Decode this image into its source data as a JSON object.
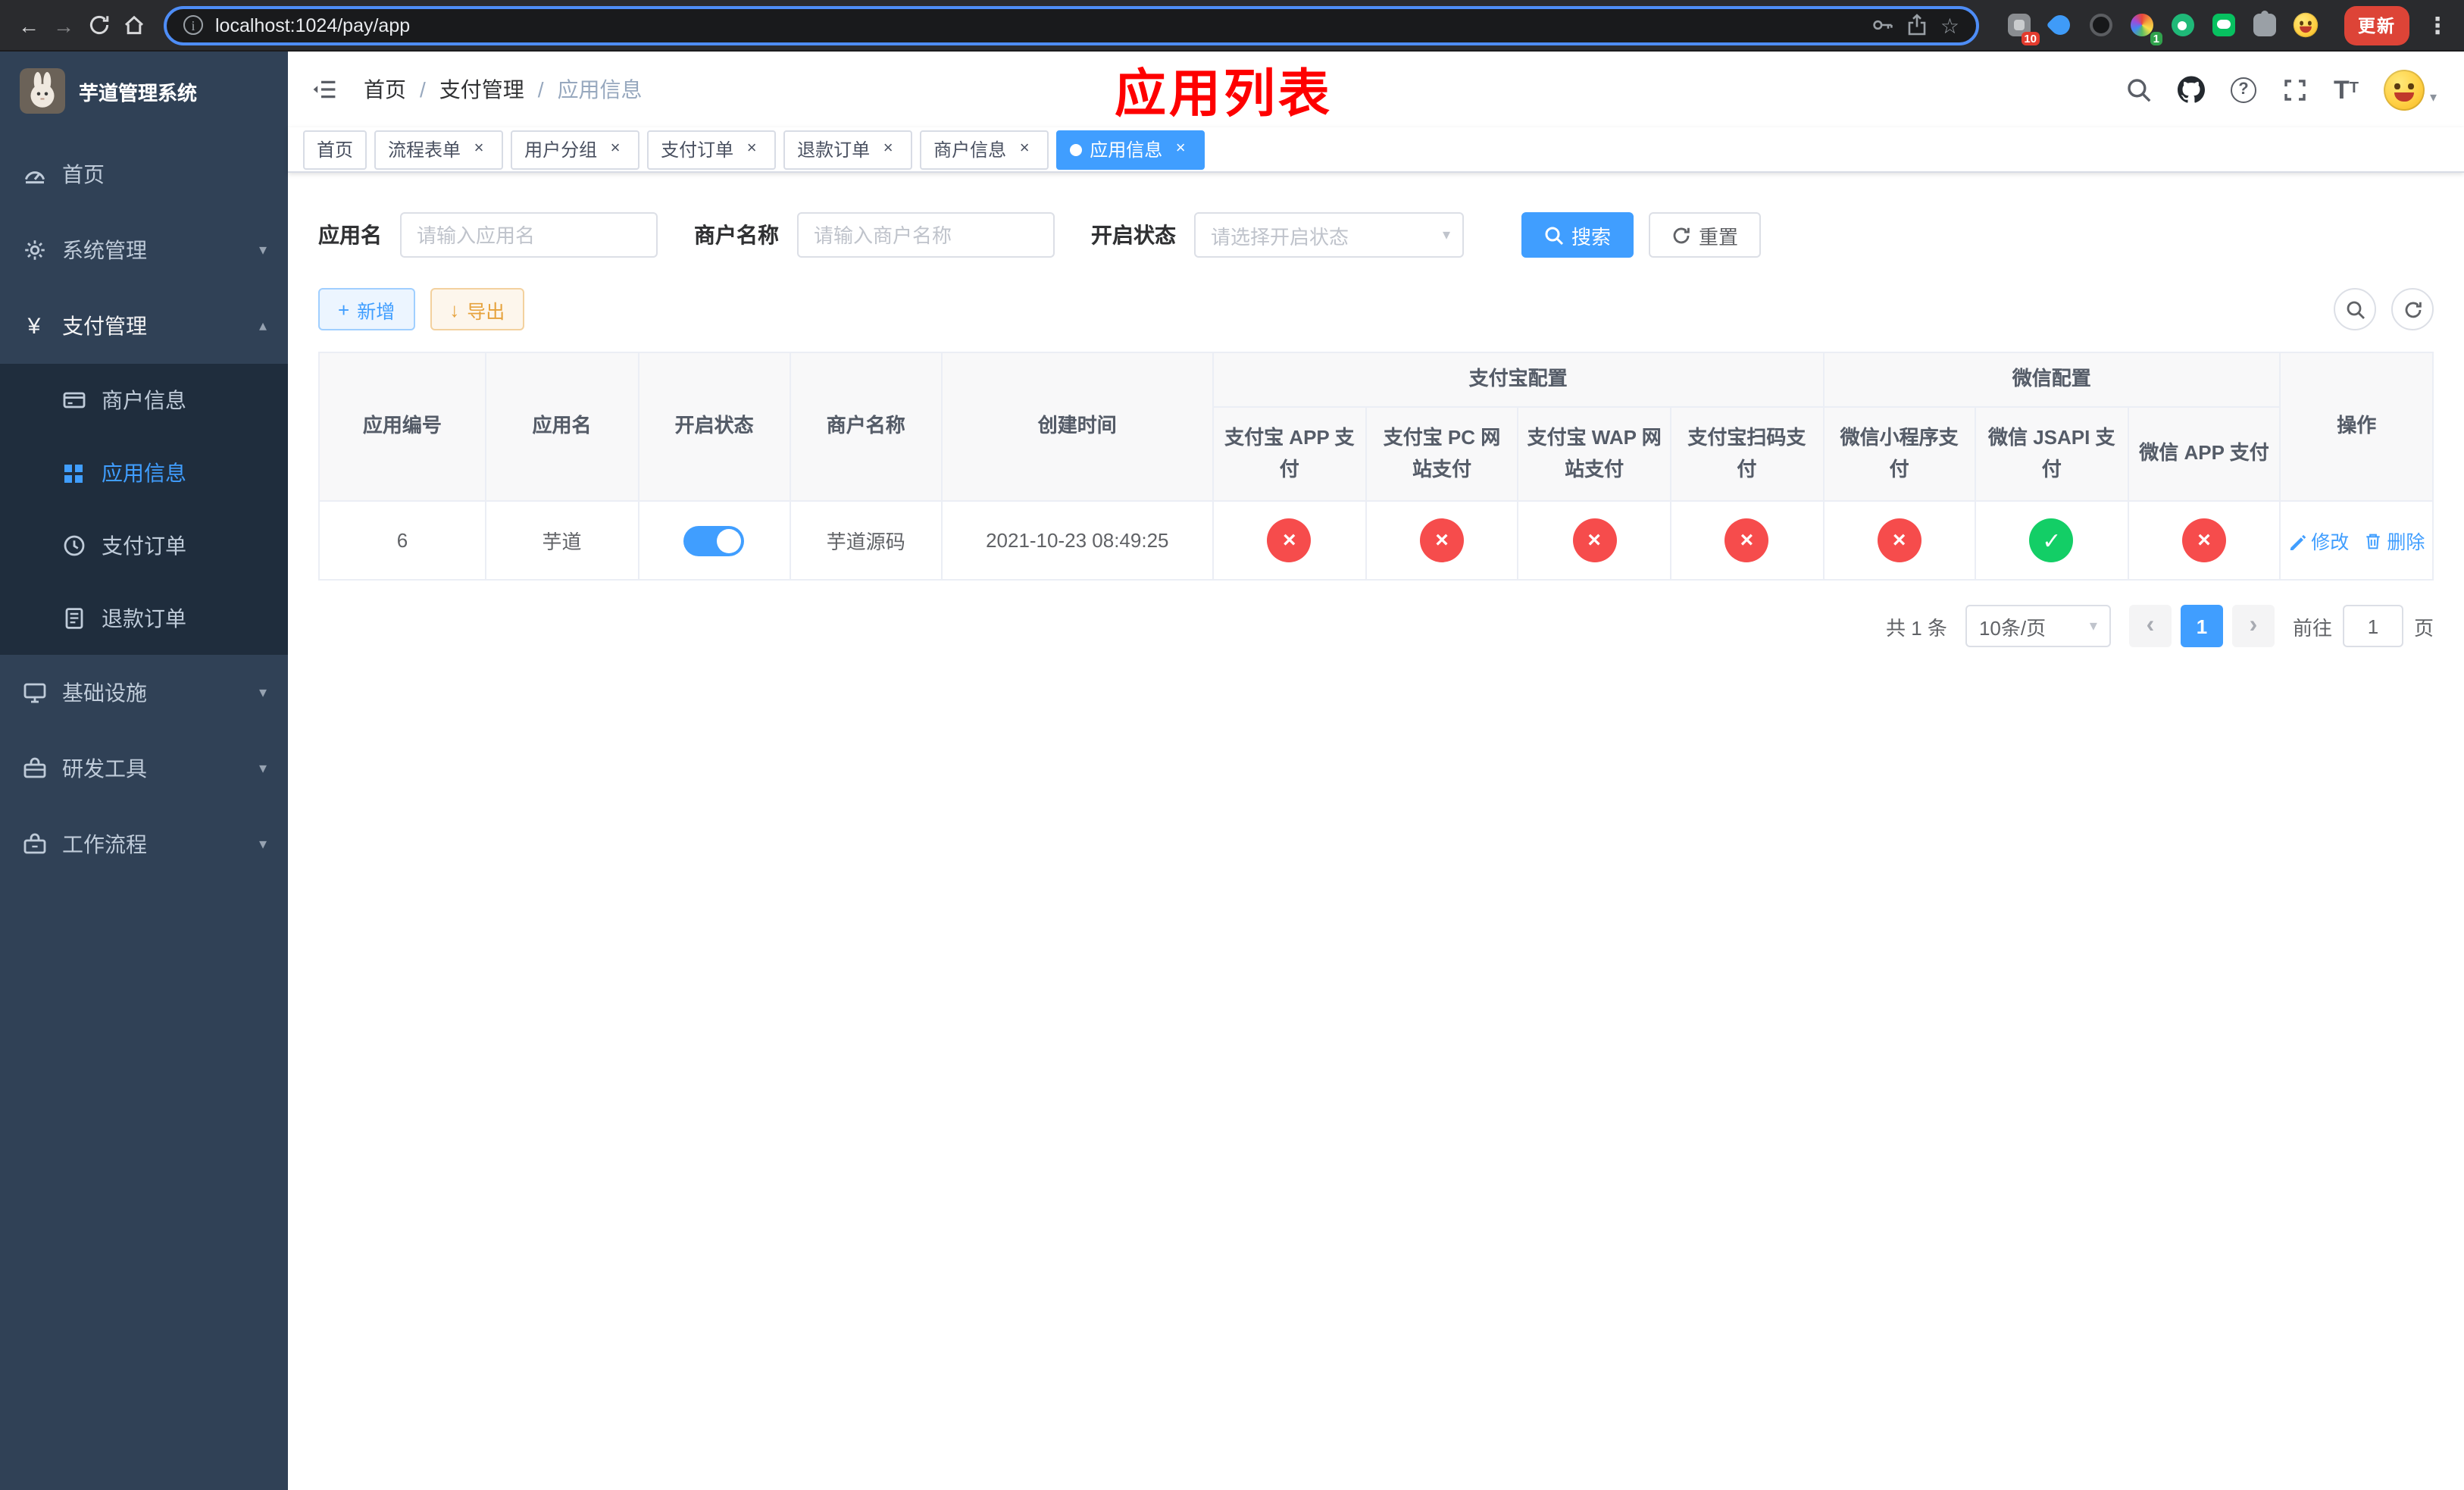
{
  "browser": {
    "url": "localhost:1024/pay/app",
    "update_label": "更新",
    "badges": {
      "tabs_count": "10",
      "notify_count": "1"
    }
  },
  "icons": {
    "back": "←",
    "forward": "→",
    "kebab": "⋮",
    "star": "☆",
    "close": "×",
    "caret_down": "▾",
    "caret_up": "▴",
    "yen": "¥",
    "prev": "‹",
    "next": "›",
    "plus": "+",
    "download": "↓",
    "info": "i",
    "question": "?",
    "font_size_large": "T",
    "font_size_small": "T"
  },
  "sidebar": {
    "logo_text": "芋道管理系统",
    "items": {
      "home": "首页",
      "system": "系统管理",
      "payment": "支付管理",
      "infra": "基础设施",
      "devtools": "研发工具",
      "workflow": "工作流程"
    },
    "payment_children": [
      "商户信息",
      "应用信息",
      "支付订单",
      "退款订单"
    ]
  },
  "header": {
    "breadcrumb": [
      "首页",
      "支付管理",
      "应用信息"
    ],
    "separator": "/",
    "title": "应用列表"
  },
  "tabs": [
    {
      "label": "首页"
    },
    {
      "label": "流程表单"
    },
    {
      "label": "用户分组"
    },
    {
      "label": "支付订单"
    },
    {
      "label": "退款订单"
    },
    {
      "label": "商户信息"
    },
    {
      "label": "应用信息"
    }
  ],
  "filters": {
    "app_name_label": "应用名",
    "app_name_placeholder": "请输入应用名",
    "merchant_label": "商户名称",
    "merchant_placeholder": "请输入商户名称",
    "status_label": "开启状态",
    "status_placeholder": "请选择开启状态",
    "search_label": "搜索",
    "reset_label": "重置"
  },
  "toolbar": {
    "add_label": "新增",
    "export_label": "导出"
  },
  "table": {
    "group_headers": {
      "alipay": "支付宝配置",
      "wechat": "微信配置"
    },
    "columns": [
      "应用编号",
      "应用名",
      "开启状态",
      "商户名称",
      "创建时间",
      "支付宝 APP 支付",
      "支付宝 PC 网站支付",
      "支付宝 WAP 网站支付",
      "支付宝扫码支付",
      "微信小程序支付",
      "微信 JSAPI 支付",
      "微信 APP 支付",
      "操作"
    ],
    "rows": [
      {
        "id": "6",
        "name": "芋道",
        "status": "on",
        "merchant": "芋道源码",
        "created": "2021-10-23 08:49:25",
        "configs": [
          "no",
          "no",
          "no",
          "no",
          "no",
          "yes",
          "no"
        ],
        "edit_label": "修改",
        "delete_label": "删除"
      }
    ]
  },
  "pagination": {
    "total": "共 1 条",
    "page_size": "10条/页",
    "current_page": "1",
    "goto_prefix": "前往",
    "goto_value": "1",
    "goto_suffix": "页"
  },
  "colors": {
    "primary": "#409eff",
    "success": "#13ce66",
    "danger": "#f64c4c",
    "warning": "#e6a23c",
    "title_red": "#fe0000",
    "sidebar_bg": "#304156",
    "sidebar_submenu_bg": "#1f2d3d",
    "sidebar_text": "#bfcbd9",
    "chrome_bg": "#2a2b2e",
    "addr_focus_ring": "#4e8df6",
    "update_button_bg": "#dd4437"
  }
}
